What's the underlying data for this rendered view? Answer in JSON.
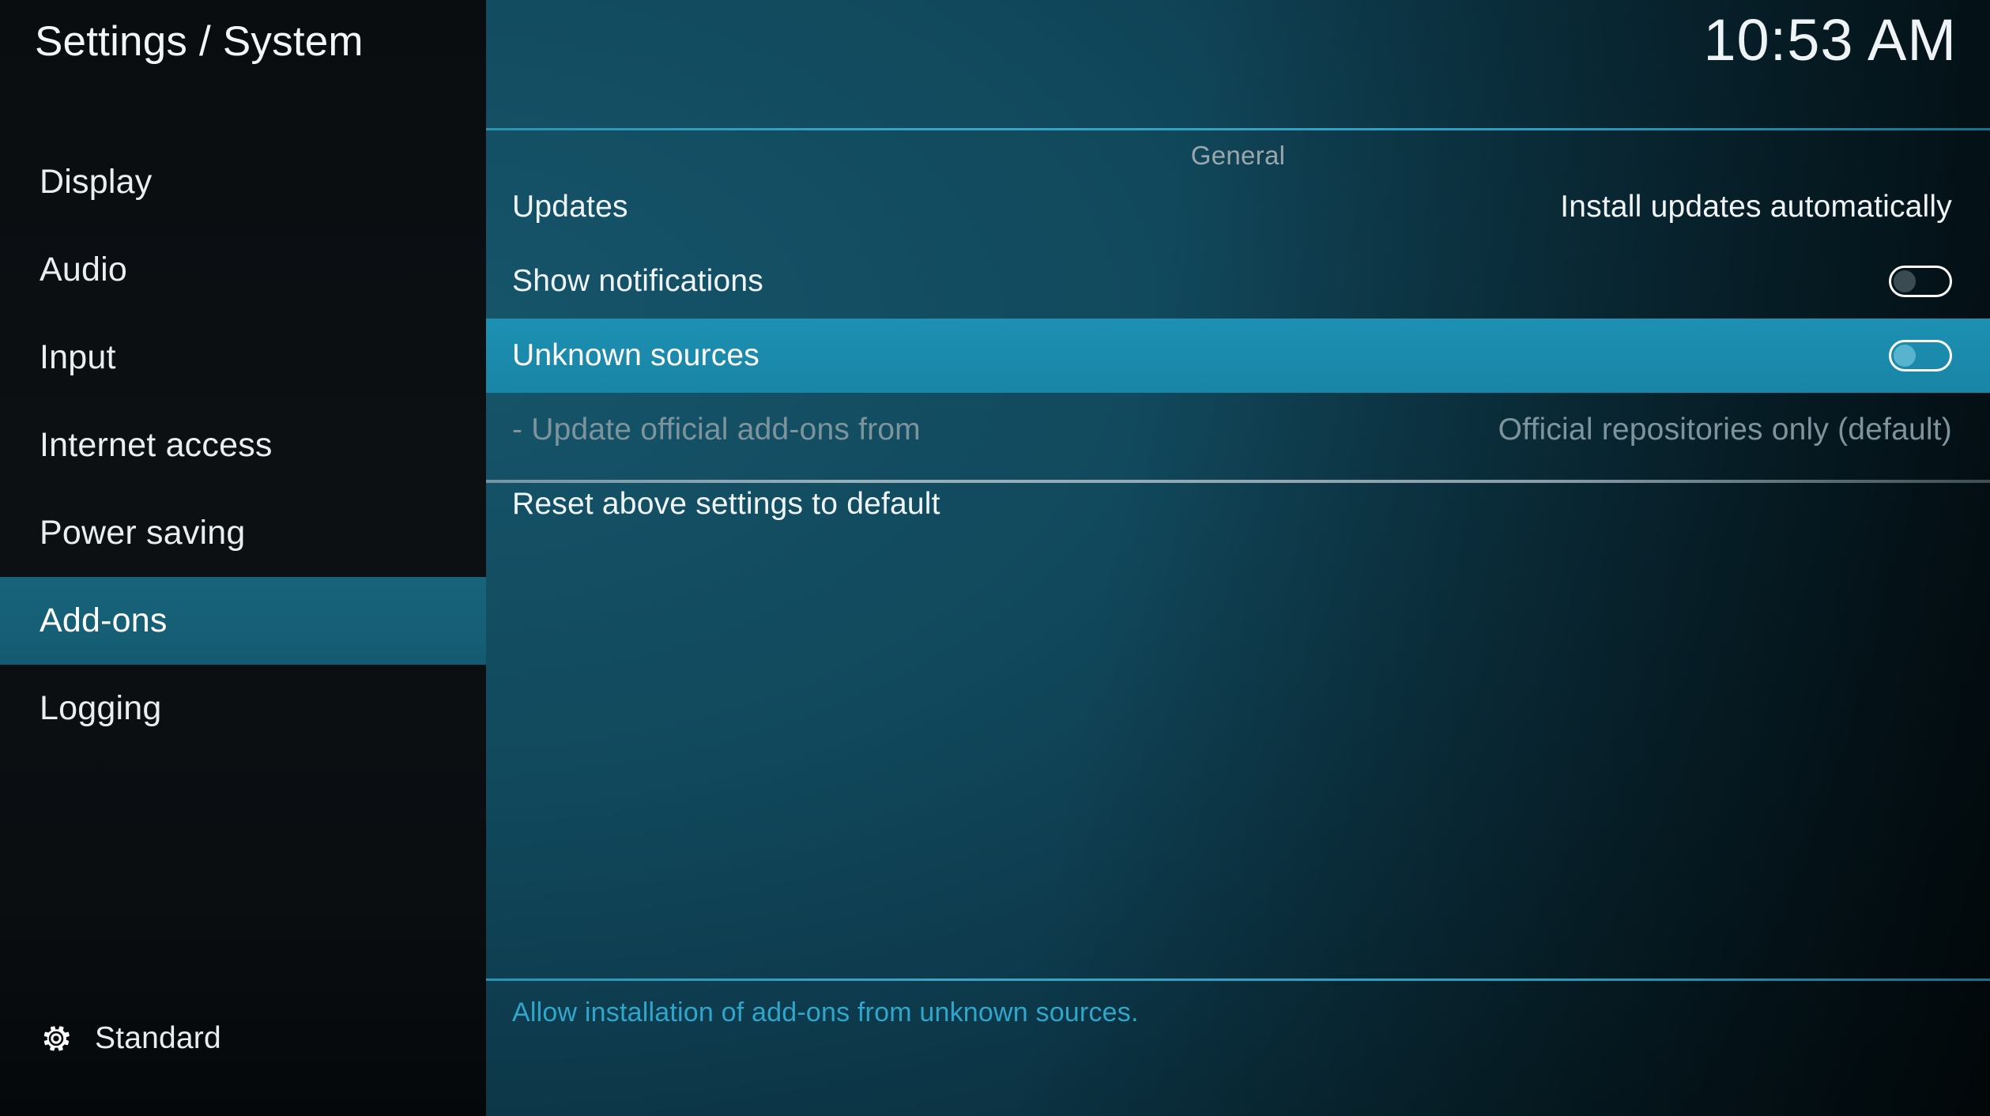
{
  "window": {
    "title": "Settings / System",
    "clock": "10:53 AM"
  },
  "colors": {
    "accent_cyan": "#2fa6cb",
    "selected_row": "#1b8aac",
    "sidebar_selected": "#166077",
    "panel_dark": "#0c3647",
    "disabled_text": "#7e949c"
  },
  "sidebar": {
    "items": [
      {
        "label": "Display",
        "selected": false
      },
      {
        "label": "Audio",
        "selected": false
      },
      {
        "label": "Input",
        "selected": false
      },
      {
        "label": "Internet access",
        "selected": false
      },
      {
        "label": "Power saving",
        "selected": false
      },
      {
        "label": "Add-ons",
        "selected": true
      },
      {
        "label": "Logging",
        "selected": false
      }
    ],
    "footer": {
      "icon": "gear-icon",
      "label": "Standard"
    }
  },
  "main": {
    "category": "General",
    "rows": [
      {
        "label": "Updates",
        "value": "Install updates automatically",
        "type": "value",
        "state": "normal"
      },
      {
        "label": "Show notifications",
        "value": "",
        "type": "toggle",
        "toggle_on": false,
        "state": "normal"
      },
      {
        "label": "Unknown sources",
        "value": "",
        "type": "toggle",
        "toggle_on": false,
        "state": "selected"
      },
      {
        "label": "- Update official add-ons from",
        "value": "Official repositories only (default)",
        "type": "value",
        "state": "disabled"
      },
      {
        "label": "Reset above settings to default",
        "value": "",
        "type": "action",
        "state": "normal"
      }
    ],
    "help_text": "Allow installation of add-ons from unknown sources."
  }
}
